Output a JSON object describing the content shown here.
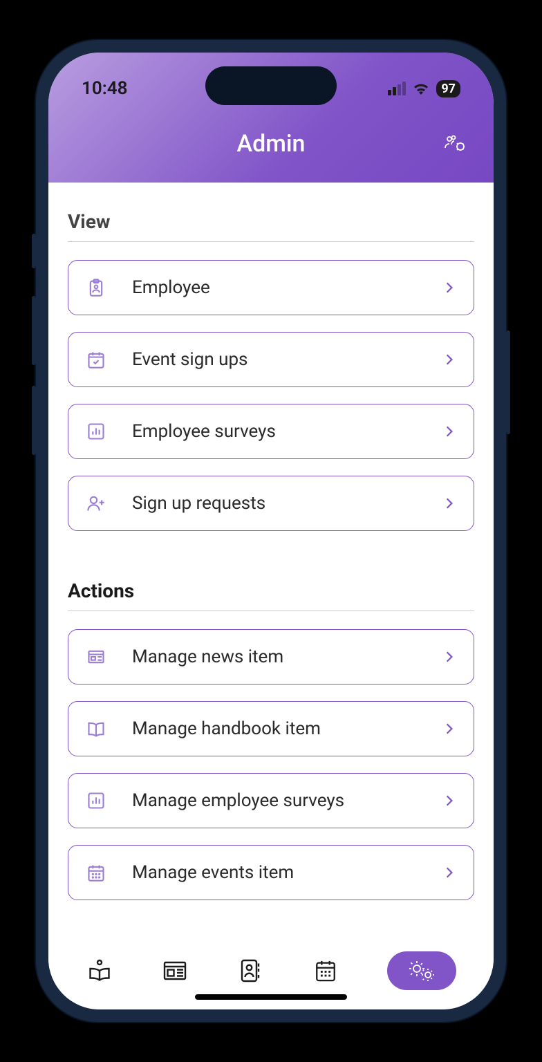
{
  "status": {
    "time": "10:48",
    "battery": "97"
  },
  "header": {
    "title": "Admin"
  },
  "sections": [
    {
      "title": "View",
      "items": [
        {
          "icon": "clipboard-user",
          "label": "Employee"
        },
        {
          "icon": "calendar-check",
          "label": "Event sign ups"
        },
        {
          "icon": "chart-bar",
          "label": "Employee surveys"
        },
        {
          "icon": "user-plus",
          "label": "Sign up requests"
        }
      ]
    },
    {
      "title": "Actions",
      "items": [
        {
          "icon": "newspaper",
          "label": "Manage news item"
        },
        {
          "icon": "book-open",
          "label": "Manage handbook item"
        },
        {
          "icon": "chart-bar",
          "label": "Manage employee surveys"
        },
        {
          "icon": "calendar-grid",
          "label": "Manage events item"
        }
      ]
    }
  ],
  "tabs": [
    {
      "icon": "reader",
      "active": false
    },
    {
      "icon": "news",
      "active": false
    },
    {
      "icon": "id-card",
      "active": false
    },
    {
      "icon": "calendar",
      "active": false
    },
    {
      "icon": "gears",
      "active": true
    }
  ]
}
